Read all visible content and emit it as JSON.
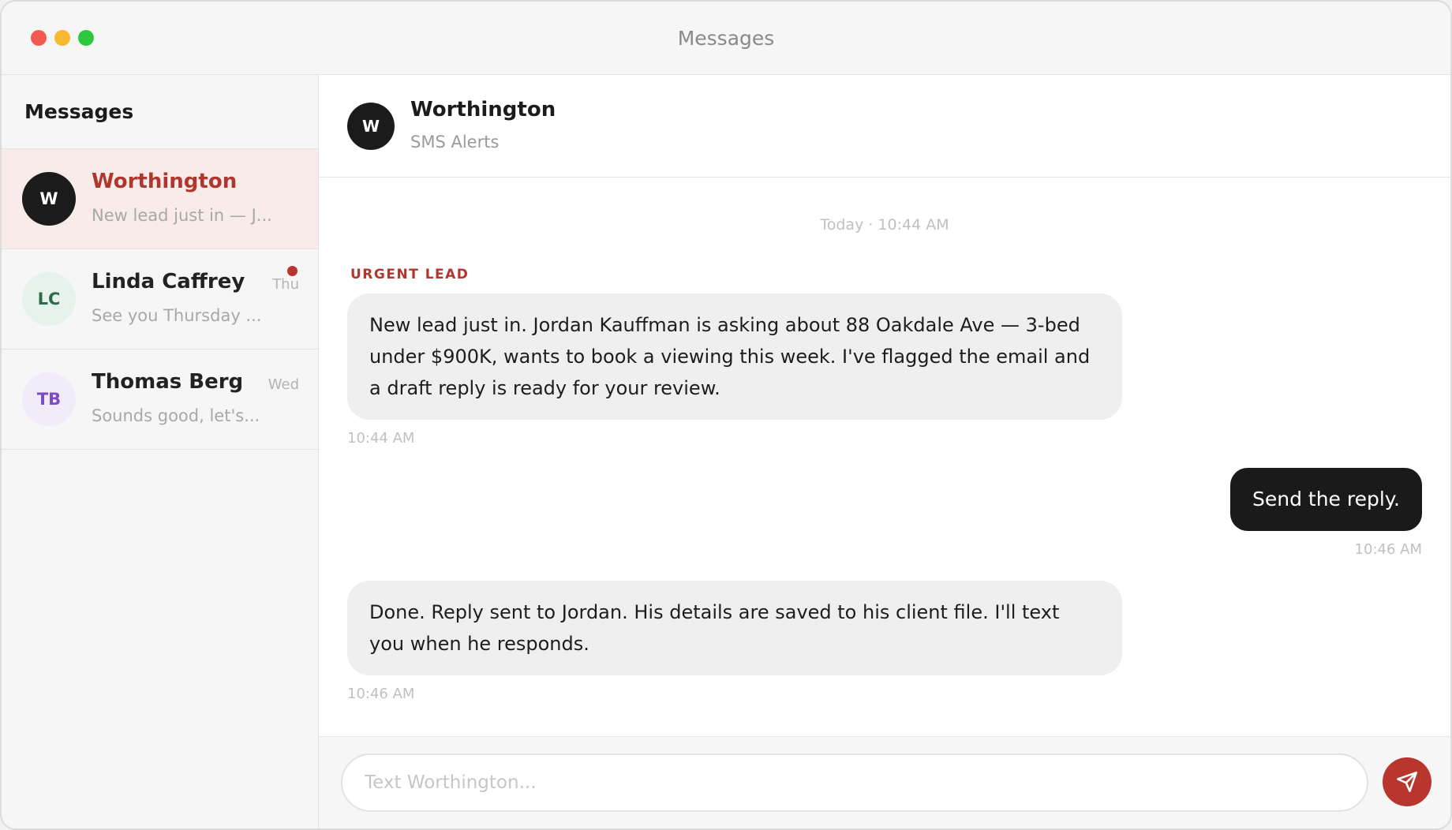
{
  "window": {
    "title": "Messages"
  },
  "sidebar": {
    "heading": "Messages",
    "conversations": [
      {
        "initials": "W",
        "name": "Worthington",
        "preview": "New lead just in — J...",
        "day": "",
        "unread": true,
        "avatar_bg": "#1b1b1b",
        "avatar_fg": "#ffffff"
      },
      {
        "initials": "LC",
        "name": "Linda Caffrey",
        "preview": "See you Thursday ...",
        "day": "Thu",
        "unread": false,
        "avatar_bg": "#e6f3ec",
        "avatar_fg": "#2d6b48"
      },
      {
        "initials": "TB",
        "name": "Thomas Berg",
        "preview": "Sounds good, let's...",
        "day": "Wed",
        "unread": false,
        "avatar_bg": "#f2ecfa",
        "avatar_fg": "#7b4cc4"
      }
    ]
  },
  "chat": {
    "avatar_initials": "W",
    "name": "Worthington",
    "subtitle": "SMS Alerts",
    "day_separator": "Today · 10:44 AM",
    "messages": [
      {
        "direction": "in",
        "tag": "URGENT LEAD",
        "text": "New lead just in. Jordan Kauffman is asking about 88 Oakdale Ave — 3-bed under $900K, wants to book a viewing this week. I've flagged the email and a draft reply is ready for your review.",
        "time": "10:44 AM"
      },
      {
        "direction": "out",
        "text": "Send the reply.",
        "time": "10:46 AM"
      },
      {
        "direction": "in",
        "text": "Done. Reply sent to Jordan. His details are saved to his client file. I'll text you when he responds.",
        "time": "10:46 AM"
      }
    ]
  },
  "composer": {
    "placeholder": "Text Worthington...",
    "value": ""
  },
  "colors": {
    "accent": "#b8362d",
    "outgoing_bubble": "#1a1a1a",
    "incoming_bubble": "#efefef"
  },
  "icons": {
    "send": "paper-plane-icon"
  }
}
